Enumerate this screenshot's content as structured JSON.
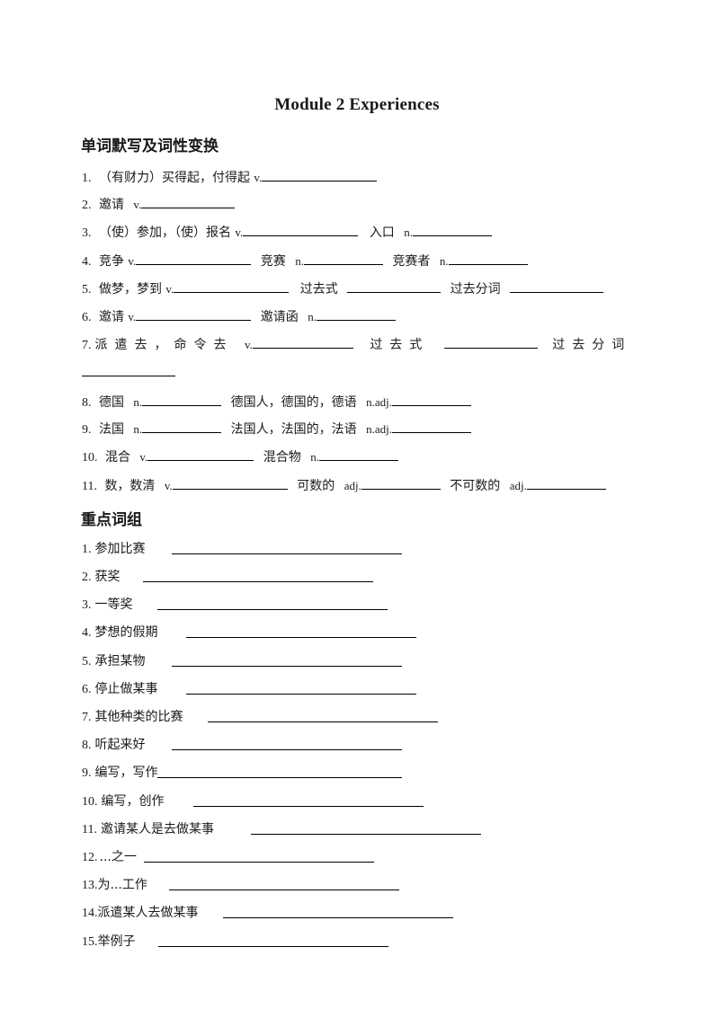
{
  "document": {
    "title": "Module 2 Experiences",
    "section1": {
      "heading": "单词默写及词性变换",
      "items": [
        {
          "num": "1.",
          "parts": [
            {
              "text": "（有财力）买得起，付得起",
              "pos": "v."
            }
          ]
        },
        {
          "num": "2.",
          "parts": [
            {
              "text": "邀请",
              "pos": "v."
            }
          ]
        },
        {
          "num": "3.",
          "parts": [
            {
              "text": "（使）参加，（使）报名",
              "pos": "v."
            },
            {
              "text": "入口",
              "pos": "n."
            }
          ]
        },
        {
          "num": "4.",
          "parts": [
            {
              "text": "竞争",
              "pos": "v."
            },
            {
              "text": "竞赛",
              "pos": "n."
            },
            {
              "text": "竞赛者",
              "pos": "n."
            }
          ]
        },
        {
          "num": "5.",
          "parts": [
            {
              "text": "做梦，梦到",
              "pos": "v."
            },
            {
              "text": "过去式",
              "pos": ""
            },
            {
              "text": "过去分词",
              "pos": ""
            }
          ]
        },
        {
          "num": "6.",
          "parts": [
            {
              "text": "邀请",
              "pos": "v."
            },
            {
              "text": "邀请函",
              "pos": "n."
            }
          ]
        },
        {
          "num": "7.",
          "parts": [
            {
              "text": "派遣去，命令去",
              "pos": "v."
            },
            {
              "text": "过去式",
              "pos": ""
            },
            {
              "text": "过去分词",
              "pos": ""
            }
          ]
        },
        {
          "num": "8.",
          "parts": [
            {
              "text": "德国",
              "pos": "n."
            },
            {
              "text": "德国人，德国的，德语",
              "pos": "n.adj."
            }
          ]
        },
        {
          "num": "9.",
          "parts": [
            {
              "text": "法国",
              "pos": "n."
            },
            {
              "text": "法国人，法国的，法语",
              "pos": "n.adj."
            }
          ]
        },
        {
          "num": "10.",
          "parts": [
            {
              "text": "混合",
              "pos": "v."
            },
            {
              "text": "混合物",
              "pos": "n."
            }
          ]
        },
        {
          "num": "11.",
          "parts": [
            {
              "text": "数，数清",
              "pos": "v."
            },
            {
              "text": "可数的",
              "pos": "adj."
            },
            {
              "text": "不可数的",
              "pos": "adj."
            }
          ]
        }
      ]
    },
    "section2": {
      "heading": "重点词组",
      "items": [
        {
          "num": "1.",
          "text": "参加比赛"
        },
        {
          "num": "2.",
          "text": "获奖"
        },
        {
          "num": "3.",
          "text": "一等奖"
        },
        {
          "num": "4.",
          "text": "梦想的假期"
        },
        {
          "num": "5.",
          "text": "承担某物"
        },
        {
          "num": "6.",
          "text": "停止做某事"
        },
        {
          "num": "7.",
          "text": "其他种类的比赛"
        },
        {
          "num": "8.",
          "text": "听起来好"
        },
        {
          "num": "9.",
          "text": "编写，写作"
        },
        {
          "num": "10.",
          "text": "编写，创作"
        },
        {
          "num": "11.",
          "text": "邀请某人是去做某事"
        },
        {
          "num": "12.",
          "text": "...之一"
        },
        {
          "num": "13.",
          "text": "为...工作"
        },
        {
          "num": "14.",
          "text": "派遣某人去做某事"
        },
        {
          "num": "15.",
          "text": "举例子"
        }
      ]
    }
  }
}
